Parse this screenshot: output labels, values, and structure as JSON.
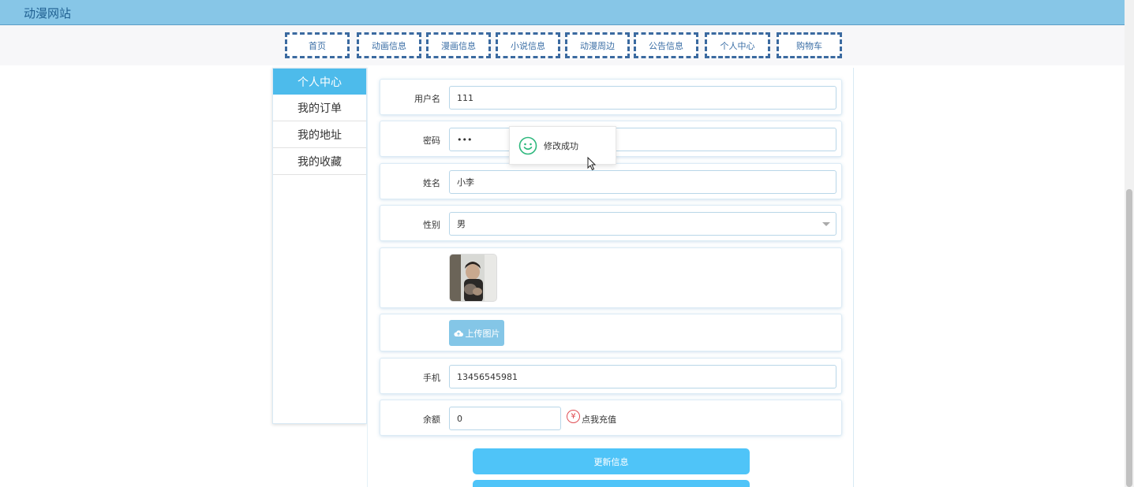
{
  "header": {
    "site_title": "动漫网站"
  },
  "nav": [
    {
      "label": "首页"
    },
    {
      "label": "动画信息"
    },
    {
      "label": "漫画信息"
    },
    {
      "label": "小说信息"
    },
    {
      "label": "动漫周边"
    },
    {
      "label": "公告信息"
    },
    {
      "label": "个人中心"
    },
    {
      "label": "购物车"
    }
  ],
  "sidebar": {
    "title": "个人中心",
    "items": [
      {
        "label": "我的订单"
      },
      {
        "label": "我的地址"
      },
      {
        "label": "我的收藏"
      }
    ]
  },
  "form": {
    "username": {
      "label": "用户名",
      "value": "111"
    },
    "password": {
      "label": "密码",
      "value": "•••"
    },
    "name": {
      "label": "姓名",
      "value": "小李"
    },
    "gender": {
      "label": "性别",
      "value": "男"
    },
    "upload_label": "上传图片",
    "phone": {
      "label": "手机",
      "value": "13456545981"
    },
    "balance": {
      "label": "余额",
      "value": "0",
      "recharge_label": "点我充值",
      "currency_icon": "¥"
    }
  },
  "buttons": {
    "update": "更新信息"
  },
  "toast": {
    "message": "修改成功",
    "icon": "smile-icon"
  },
  "colors": {
    "topbar": "#87c6e7",
    "nav_border": "#3b6aa0",
    "sidebar_header": "#4dbbeb",
    "primary_button": "#4fc4f8",
    "upload_button": "#84c6e7",
    "success": "#2db87d",
    "currency": "#e04f55"
  }
}
